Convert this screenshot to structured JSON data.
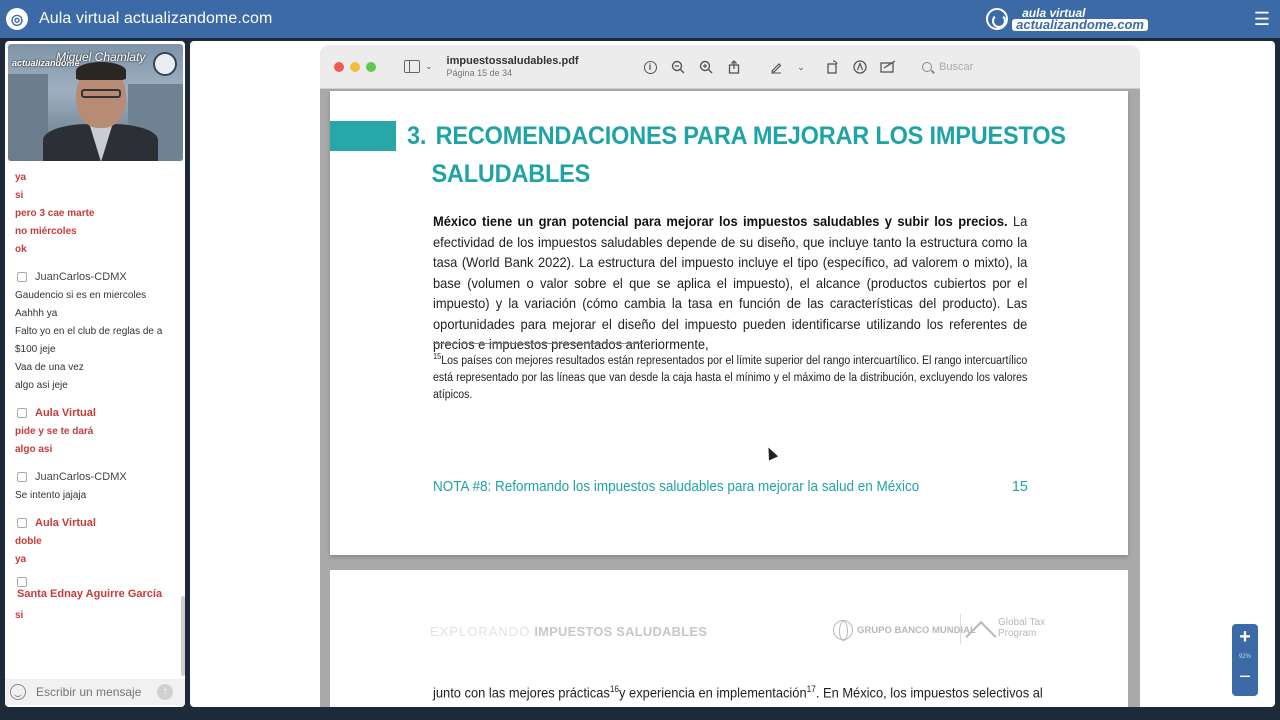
{
  "app": {
    "title": "Aula virtual actualizandome.com",
    "brand_line1": "aula virtual",
    "brand_line2": "actualizandome.com",
    "icon": "globe-icon",
    "menu_icon": "hamburger-icon"
  },
  "video": {
    "presenter_name": "Miguel Chamlaty",
    "watermark": "actualizandome"
  },
  "chat": {
    "messages_top": [
      "ya",
      "si",
      "pero 3 cae marte",
      "no miércoles",
      "ok"
    ],
    "blocks": [
      {
        "author": "JuanCarlos-CDMX",
        "is_host": false,
        "lines": [
          "Gaudencio si es en miercoles",
          "Aahhh ya",
          "Falto yo en el club de reglas de a",
          "$100 jeje",
          "Vaa de una vez",
          "algo asi jeje"
        ]
      },
      {
        "author": "Aula Virtual",
        "is_host": true,
        "lines": [
          "pide y se te dará",
          "algo asi"
        ]
      },
      {
        "author": "JuanCarlos-CDMX",
        "is_host": false,
        "lines": [
          "Se intento jajaja"
        ]
      },
      {
        "author": "Aula Virtual",
        "is_host": true,
        "lines": [
          "doble",
          "ya"
        ]
      },
      {
        "author": "Santa Ednay Aguirre García",
        "is_host": true,
        "lines": [
          "si"
        ]
      }
    ],
    "input_placeholder": "Escribir un mensaje"
  },
  "viewer": {
    "filename": "impuestossaludables.pdf",
    "page_info": "Página 15 de 34",
    "search_placeholder": "Buscar",
    "tool_icons": [
      "info-icon",
      "zoom-out-icon",
      "zoom-in-icon",
      "share-icon",
      "markup-pen-icon",
      "chevron-down-icon",
      "rotate-icon",
      "annotate-icon",
      "form-icon"
    ]
  },
  "document": {
    "section_number": "3.",
    "heading_line1": "RECOMENDACIONES PARA MEJORAR LOS IMPUESTOS",
    "heading_line2": "SALUDABLES",
    "para_bold": "México tiene un gran potencial para mejorar los impuestos saludables y subir los precios.",
    "para_rest": " La efectividad de los impuestos saludables depende de su diseño, que incluye tanto la estructura como la tasa (World Bank 2022). La estructura del impuesto incluye el tipo (específico, ad valorem o mixto), la base (volumen o valor sobre el que se aplica el impuesto), el alcance (productos cubiertos por el impuesto) y la variación (cómo cambia la tasa en función de las características del producto). Las oportunidades para mejorar el diseño del impuesto pueden identificarse utilizando los referentes de precios e impuestos presentados anteriormente,",
    "footnote_mark": "15",
    "footnote_text": "Los países con mejores resultados están representados por el límite superior del rango intercuartílico. El rango intercuartílico está representado por las líneas que van desde la caja hasta el mínimo y el máximo de la distribución, excluyendo los valores atípicos.",
    "footer_note": "NOTA #8: Reformando los impuestos saludables para mejorar la salud en México",
    "page_number": "15",
    "page2_header_light": "EXPLORANDO",
    "page2_header_bold": "IMPUESTOS SALUDABLES",
    "page2_wb": "GRUPO BANCO MUNDIAL",
    "page2_gtp_1": "Global Tax",
    "page2_gtp_2": "Program",
    "page2_text_a": "junto con las mejores prácticas",
    "page2_sup1": "16",
    "page2_text_b": "y experiencia en implementación",
    "page2_sup2": "17",
    "page2_text_c": ". En México, los impuestos selectivos al"
  },
  "zoom": {
    "in_label": "+",
    "level": "92%",
    "out_label": "−"
  },
  "colors": {
    "topbar": "#3b6aa6",
    "teal": "#1fa3a6",
    "chat_red": "#c93a3a"
  }
}
